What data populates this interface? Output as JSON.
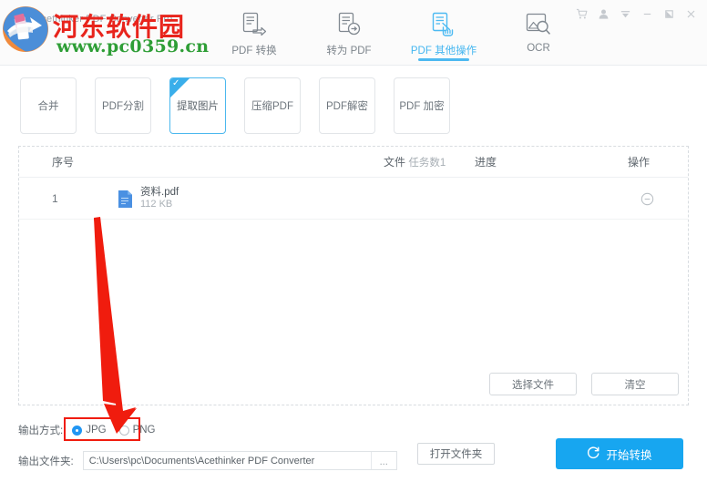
{
  "window": {
    "title": "Acethinker PDF Converter Pro",
    "controls": [
      {
        "name": "cart-icon",
        "label": "Cart"
      },
      {
        "name": "user-icon",
        "label": "Account"
      },
      {
        "name": "menu-icon",
        "label": "Menu"
      },
      {
        "name": "minimize-icon",
        "label": "Minimize"
      },
      {
        "name": "maximize-icon",
        "label": "Maximize"
      },
      {
        "name": "close-icon",
        "label": "Close"
      }
    ]
  },
  "tabs": [
    {
      "label": "PDF 转换",
      "icon": "pdf-convert-icon",
      "active": false
    },
    {
      "label": "转为 PDF",
      "icon": "to-pdf-icon",
      "active": false
    },
    {
      "label": "PDF 其他操作",
      "icon": "pdf-other-icon",
      "active": true
    },
    {
      "label": "OCR",
      "icon": "ocr-icon",
      "active": false
    }
  ],
  "operations": [
    {
      "label": "合并",
      "selected": false
    },
    {
      "label": "PDF分割",
      "selected": false
    },
    {
      "label": "提取图片",
      "selected": true
    },
    {
      "label": "压缩PDF",
      "selected": false
    },
    {
      "label": "PDF解密",
      "selected": false
    },
    {
      "label": "PDF 加密",
      "selected": false
    }
  ],
  "table": {
    "headers": {
      "index": "序号",
      "file": "文件",
      "file_count": "任务数1",
      "progress": "进度",
      "action": "操作"
    },
    "rows": [
      {
        "index": "1",
        "name": "资料.pdf",
        "size": "112 KB",
        "progress": "",
        "action_icon": "remove-circle-icon"
      }
    ],
    "footer_buttons": [
      {
        "label": "选择文件",
        "name": "select-file-button"
      },
      {
        "label": "清空",
        "name": "clear-button"
      }
    ]
  },
  "bottom": {
    "format_label": "输出方式:",
    "formats": [
      {
        "label": "JPG",
        "selected": true
      },
      {
        "label": "PNG",
        "selected": false
      }
    ],
    "folder_label": "输出文件夹:",
    "folder_path": "C:\\Users\\pc\\Documents\\Acethinker PDF Converter",
    "browse_label": "...",
    "open_folder_label": "打开文件夹",
    "start_label": "开始转换"
  },
  "watermark": {
    "site_name": "河东软件园",
    "site_url": "www.pc0359.cn"
  },
  "colors": {
    "accent": "#17a6f0",
    "tab_active": "#44b6f0",
    "annotation_red": "#f01c0e",
    "watermark_red": "#e8241c",
    "watermark_green": "#2e9e36"
  }
}
